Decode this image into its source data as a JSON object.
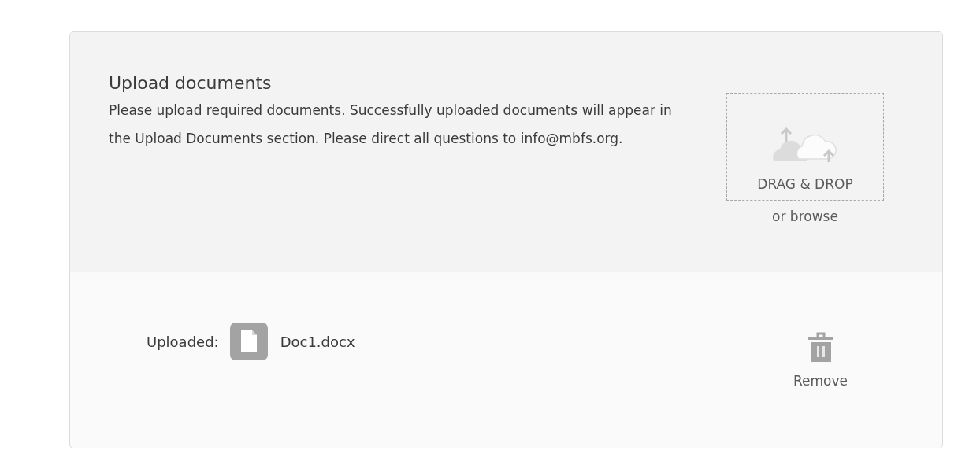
{
  "upload": {
    "title": "Upload documents",
    "description": "Please upload required documents. Successfully uploaded documents will appear in the Upload Documents section. Please direct all questions to info@mbfs.org.",
    "dropzone": {
      "label": "DRAG & DROP",
      "browse": "or browse"
    }
  },
  "uploaded": {
    "label": "Uploaded:",
    "file": "Doc1.docx",
    "remove": "Remove"
  }
}
